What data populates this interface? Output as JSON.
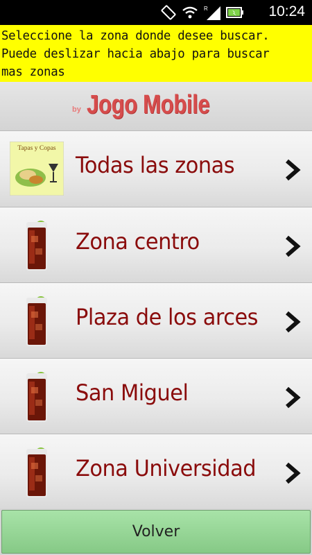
{
  "status_bar": {
    "time": "10:24",
    "icons": [
      "screen-rotate-icon",
      "wifi-icon",
      "signal-icon",
      "battery-icon"
    ]
  },
  "instructions": {
    "text": "Seleccione la zona donde desee buscar.\nPuede deslizar hacia abajo para buscar\nmas zonas"
  },
  "brand": {
    "by": "by",
    "name": "Jogo Mobile"
  },
  "zones": [
    {
      "label": "Todas las zonas",
      "thumbnail": "tapas-y-copas-logo",
      "thumbnail_text": "Tapas y Copas"
    },
    {
      "label": "Zona centro",
      "thumbnail": "cocktail-glass-icon"
    },
    {
      "label": "Plaza de los arces",
      "thumbnail": "cocktail-glass-icon"
    },
    {
      "label": "San Miguel",
      "thumbnail": "cocktail-glass-icon"
    },
    {
      "label": "Zona Universidad",
      "thumbnail": "cocktail-glass-icon"
    }
  ],
  "back_button": {
    "label": "Volver"
  },
  "colors": {
    "instruction_bg": "#ffff00",
    "brand_red": "#d64c4c",
    "zone_text": "#8a0c0c",
    "button_green": "#94d394"
  }
}
